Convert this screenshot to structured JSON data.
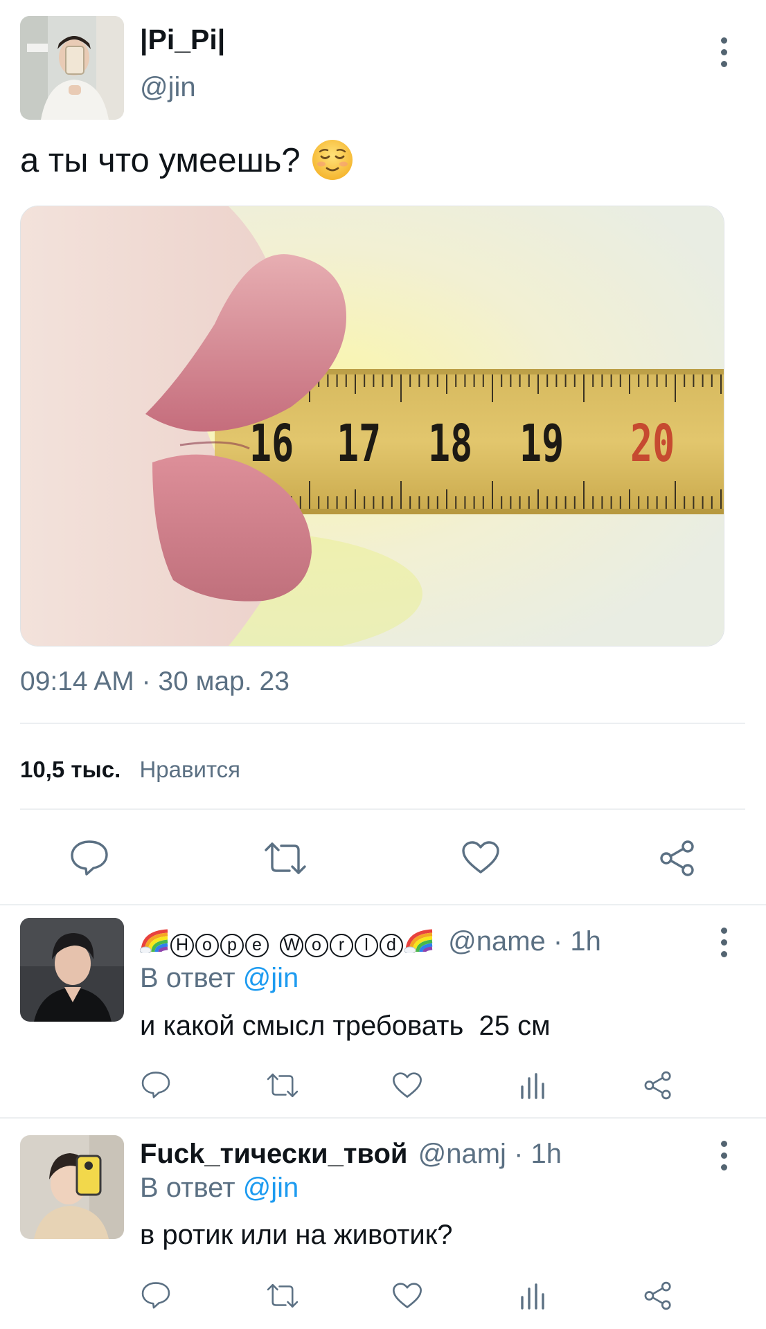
{
  "tweet": {
    "display_name": "|Pi_Pi|",
    "handle": "@jin",
    "text": "а ты что умеешь?",
    "emoji": "relieved-face",
    "image_ruler_numbers": [
      "16",
      "17",
      "18",
      "19",
      "20"
    ],
    "timestamp": "09:14 AM · 30 мар. 23",
    "likes_count": "10,5 тыс.",
    "likes_label": "Нравится"
  },
  "actions": [
    "reply-icon",
    "retweet-icon",
    "like-icon",
    "share-icon"
  ],
  "replies": [
    {
      "display_name_letters": [
        "H",
        "o",
        "p",
        "e",
        "W",
        "o",
        "r",
        "l",
        "d"
      ],
      "display_name_emoji": "rainbow",
      "handle": "@name",
      "time": "· 1h",
      "in_reply_prefix": "В ответ",
      "in_reply_to": "@jin",
      "text": "и какой смысл требовать  25 см"
    },
    {
      "display_name": "Fuck_тически_твой",
      "handle": "@namj",
      "time": "· 1h",
      "in_reply_prefix": "В ответ",
      "in_reply_to": "@jin",
      "text": "в ротик или на животик?"
    }
  ],
  "colors": {
    "link": "#1d9bf0",
    "secondary_text": "#5b7083",
    "primary_text": "#0f1419",
    "divider": "#eceff1"
  }
}
